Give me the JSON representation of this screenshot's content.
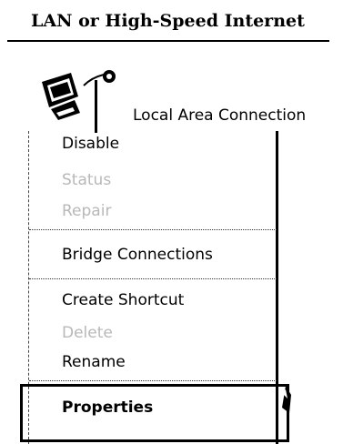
{
  "group": {
    "title": "LAN or High-Speed Internet"
  },
  "connection": {
    "name": "Local Area Connection",
    "icon": "network-connection-icon"
  },
  "menu": {
    "items": [
      {
        "label": "Disable",
        "enabled": true
      },
      {
        "label": "Status",
        "enabled": false
      },
      {
        "label": "Repair",
        "enabled": false
      },
      {
        "label": "Bridge Connections",
        "enabled": true
      },
      {
        "label": "Create Shortcut",
        "enabled": true
      },
      {
        "label": "Delete",
        "enabled": false
      },
      {
        "label": "Rename",
        "enabled": true
      },
      {
        "label": "Properties",
        "enabled": true,
        "highlighted": true
      }
    ]
  }
}
